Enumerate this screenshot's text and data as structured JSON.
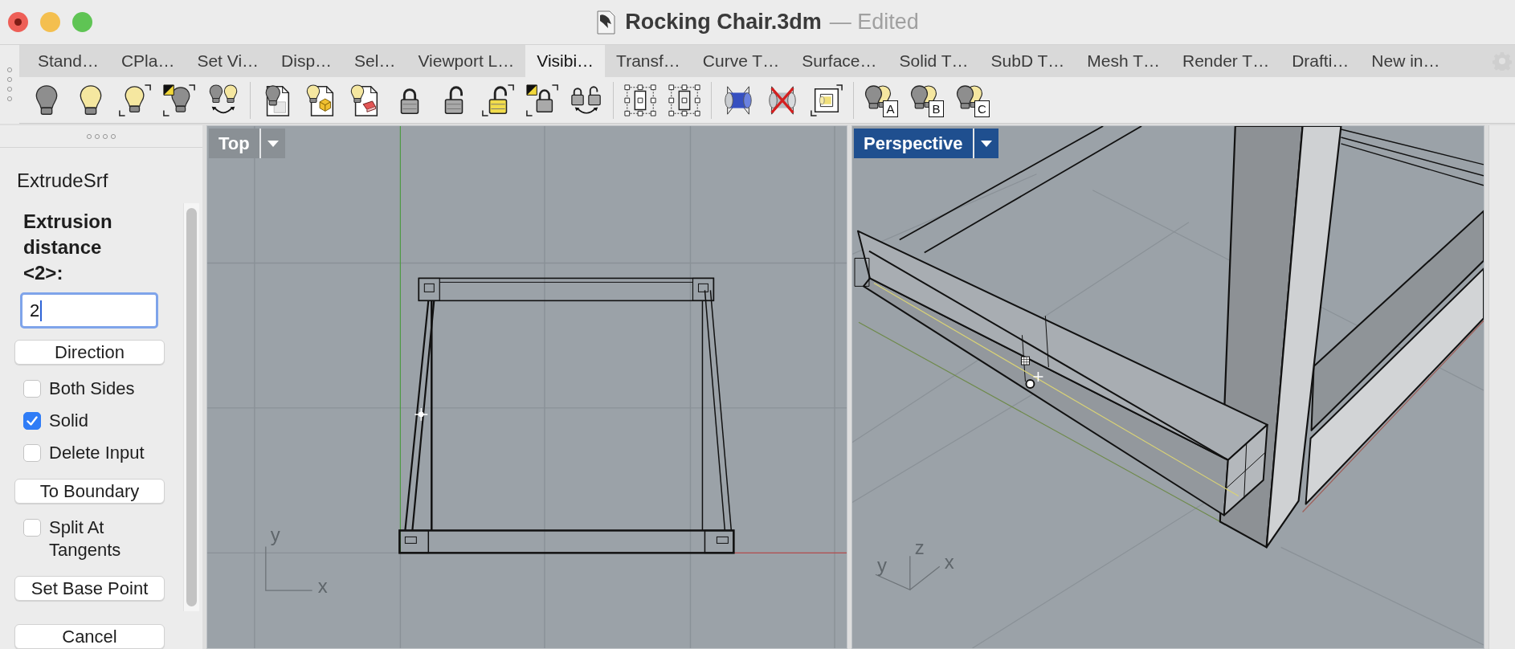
{
  "window": {
    "title": "Rocking Chair.3dm",
    "subtitle": "— Edited"
  },
  "tabs": [
    {
      "label": "Stand…",
      "selected": false
    },
    {
      "label": "CPla…",
      "selected": false
    },
    {
      "label": "Set Vi…",
      "selected": false
    },
    {
      "label": "Disp…",
      "selected": false
    },
    {
      "label": "Sel…",
      "selected": false
    },
    {
      "label": "Viewport L…",
      "selected": false
    },
    {
      "label": "Visibi…",
      "selected": true
    },
    {
      "label": "Transf…",
      "selected": false
    },
    {
      "label": "Curve T…",
      "selected": false
    },
    {
      "label": "Surface…",
      "selected": false
    },
    {
      "label": "Solid T…",
      "selected": false
    },
    {
      "label": "SubD T…",
      "selected": false
    },
    {
      "label": "Mesh T…",
      "selected": false
    },
    {
      "label": "Render T…",
      "selected": false
    },
    {
      "label": "Drafti…",
      "selected": false
    },
    {
      "label": "New in…",
      "selected": false
    }
  ],
  "toolbar": {
    "lettered_buttons": [
      {
        "letter": "A"
      },
      {
        "letter": "B"
      },
      {
        "letter": "C"
      }
    ]
  },
  "command_panel": {
    "command": "ExtrudeSrf",
    "prompt": "Extrusion distance <2>:",
    "input": {
      "value": "2"
    },
    "options": [
      {
        "kind": "button",
        "label": "Direction"
      },
      {
        "kind": "checkbox",
        "label": "Both Sides",
        "checked": false
      },
      {
        "kind": "checkbox",
        "label": "Solid",
        "checked": true
      },
      {
        "kind": "checkbox",
        "label": "Delete Input",
        "checked": false
      },
      {
        "kind": "button",
        "label": "To Boundary"
      },
      {
        "kind": "checkbox",
        "label": "Split At Tangents",
        "checked": false
      },
      {
        "kind": "button",
        "label": "Set Base Point"
      }
    ],
    "cancel": "Cancel"
  },
  "viewports": [
    {
      "kind": "top",
      "title": "Top",
      "selected": false,
      "axis_labels": [
        "y",
        "x"
      ]
    },
    {
      "kind": "perspective",
      "title": "Perspective",
      "selected": true,
      "axis_labels": [
        "y",
        "z",
        "x"
      ]
    }
  ]
}
